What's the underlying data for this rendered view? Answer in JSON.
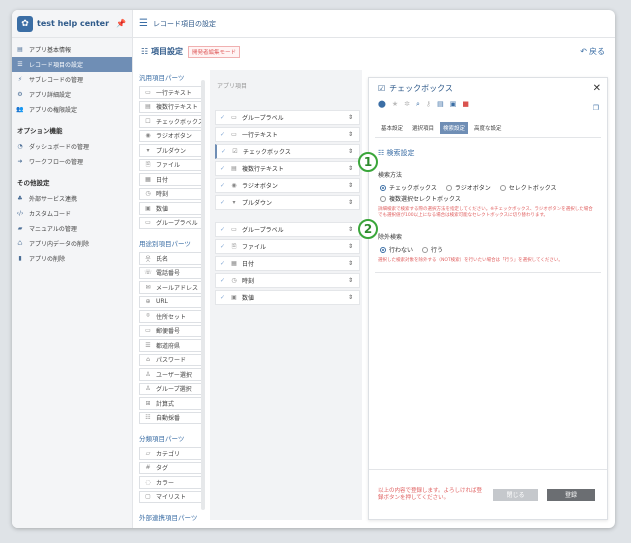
{
  "app": {
    "name": "test help center",
    "pin_icon": "pin-icon"
  },
  "topbar": {
    "title": "レコード項目の設定"
  },
  "sidebar": {
    "items": [
      {
        "label": "アプリ基本情報",
        "icon": "app-info-icon",
        "active": false
      },
      {
        "label": "レコード項目の設定",
        "icon": "list-icon",
        "active": true
      },
      {
        "label": "サブレコードの管理",
        "icon": "subrecord-icon",
        "active": false
      },
      {
        "label": "アプリ詳細設定",
        "icon": "gear-icon",
        "active": false
      },
      {
        "label": "アプリの権限設定",
        "icon": "users-icon",
        "active": false
      }
    ],
    "options_title": "オプション機能",
    "options": [
      {
        "label": "ダッシュボードの管理",
        "icon": "dashboard-icon"
      },
      {
        "label": "ワークフローの管理",
        "icon": "workflow-icon"
      }
    ],
    "other_title": "その他設定",
    "other": [
      {
        "label": "外部サービス連携",
        "icon": "link-icon"
      },
      {
        "label": "カスタムコード",
        "icon": "code-icon"
      },
      {
        "label": "マニュアルの管理",
        "icon": "book-icon"
      },
      {
        "label": "アプリ内データの削除",
        "icon": "data-delete-icon"
      },
      {
        "label": "アプリの削除",
        "icon": "trash-icon"
      }
    ]
  },
  "subhead": {
    "title": "項目設定",
    "badge": "開発者編集モード",
    "back": "戻る"
  },
  "parts": {
    "generic_title": "汎用項目パーツ",
    "generic": [
      "一行テキスト",
      "複数行テキスト",
      "チェックボックス",
      "ラジオボタン",
      "プルダウン",
      "ファイル",
      "日付",
      "時刻",
      "数値",
      "グループラベル"
    ],
    "specific_title": "用途別項目パーツ",
    "specific": [
      "氏名",
      "電話番号",
      "メールアドレス",
      "URL",
      "住所セット",
      "郵便番号",
      "都道府県",
      "パスワード",
      "ユーザー選択",
      "グループ選択",
      "計算式",
      "自動採番"
    ],
    "category_title": "分類項目パーツ",
    "category": [
      "カテゴリ",
      "タグ",
      "カラー",
      "マイリスト"
    ],
    "external_title": "外部連携項目パーツ"
  },
  "form": {
    "caption": "アプリ項目",
    "rows": [
      {
        "label": "グループラベル",
        "icon": "folder-icon",
        "selected": false
      },
      {
        "label": "一行テキスト",
        "icon": "textbox-icon",
        "selected": false
      },
      {
        "label": "チェックボックス",
        "icon": "checkbox-icon",
        "selected": true
      },
      {
        "label": "複数行テキスト",
        "icon": "doc-icon",
        "selected": false
      },
      {
        "label": "ラジオボタン",
        "icon": "radio-icon",
        "selected": false
      },
      {
        "label": "プルダウン",
        "icon": "dropdown-icon",
        "selected": false
      }
    ],
    "rows2": [
      {
        "label": "グループラベル",
        "icon": "folder-icon"
      },
      {
        "label": "ファイル",
        "icon": "file-icon"
      },
      {
        "label": "日付",
        "icon": "calendar-icon"
      },
      {
        "label": "時刻",
        "icon": "clock-icon"
      },
      {
        "label": "数値",
        "icon": "number-icon"
      }
    ]
  },
  "panel": {
    "title": "チェックボックス",
    "tabs": [
      "基本設定",
      "選択項目",
      "検索設定",
      "高度な設定"
    ],
    "active_tab": 2,
    "section": "検索設定",
    "method_label": "検索方法",
    "methods": [
      "チェックボックス",
      "ラジオボタン",
      "セレクトボックス",
      "複数選択セレクトボックス"
    ],
    "method_note": "詳細検索で検索する際の選択方法を指定してください。※チェックボックス、ラジオボタンを選択した場合でも選択値が100以上になる場合は検索可能なセレクトボックスに切り替わります。",
    "exclude_label": "除外検索",
    "excludes": [
      "行わない",
      "行う"
    ],
    "exclude_note": "選択した検索対象を除外する（NOT検索）を行いたい場合は「行う」を選択してください。",
    "footer_msg": "以上の内容で登録します。よろしければ登録ボタンを押してください。",
    "close_btn": "閉じる",
    "save_btn": "登録",
    "markers": [
      "1",
      "2"
    ]
  }
}
